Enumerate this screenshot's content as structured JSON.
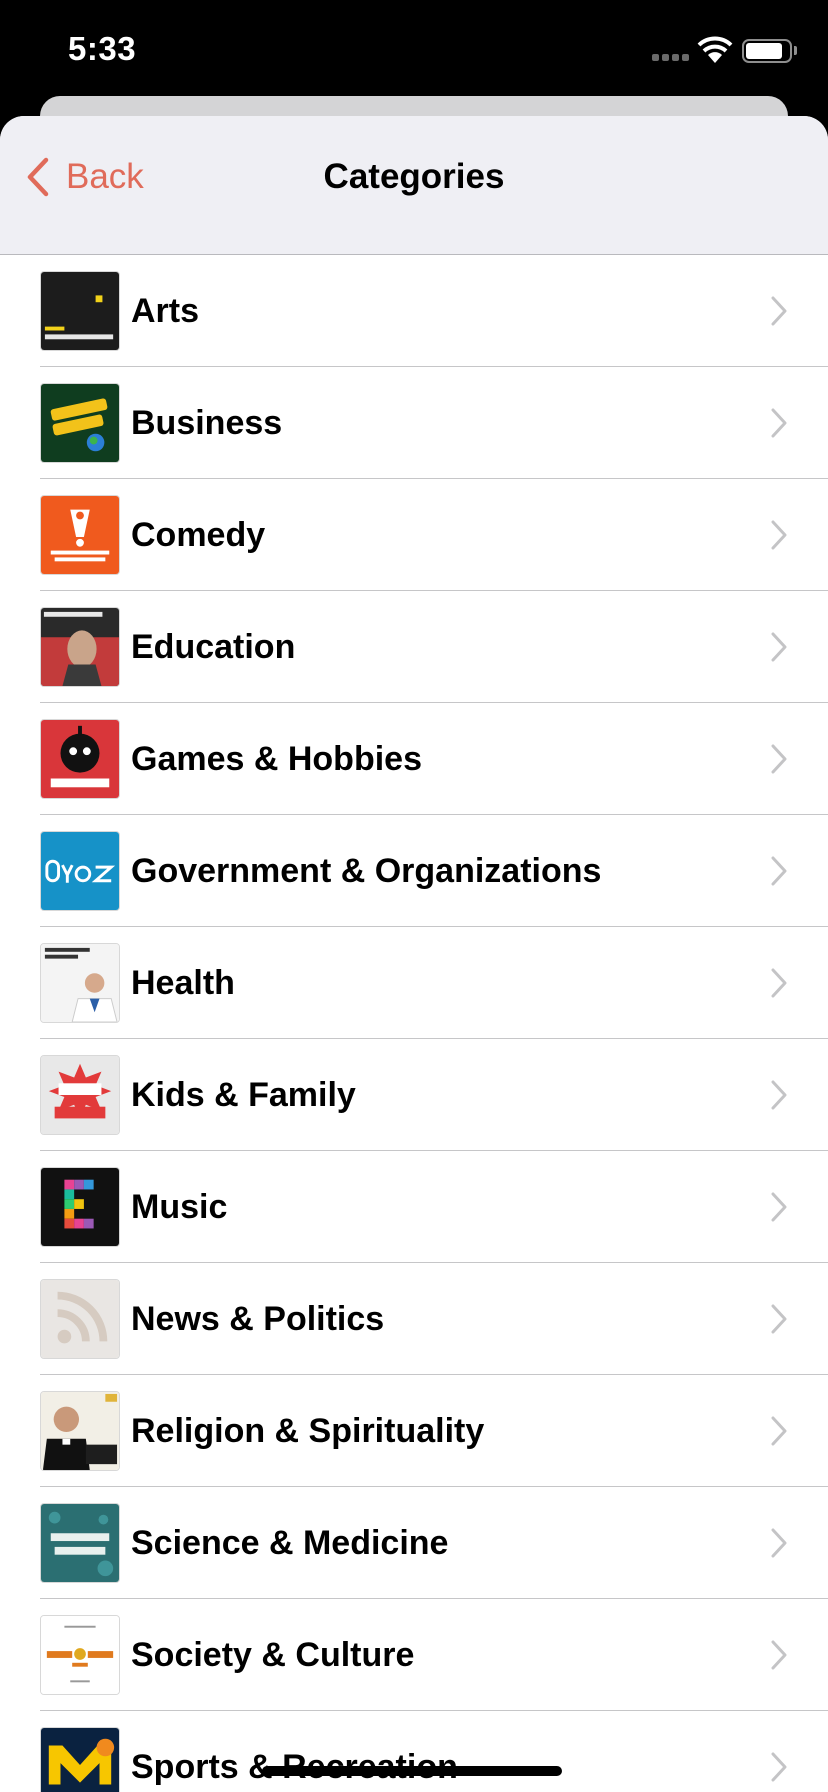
{
  "status_bar": {
    "time": "5:33"
  },
  "nav": {
    "back_label": "Back",
    "title": "Categories"
  },
  "categories": [
    {
      "label": "Arts",
      "thumb_icon": "99-invisible-art",
      "thumb_color": "#1c1c1c"
    },
    {
      "label": "Business",
      "thumb_icon": "planet-money-art",
      "thumb_color": "#0f3d1f"
    },
    {
      "label": "Comedy",
      "thumb_icon": "wait-wait-art",
      "thumb_color": "#f05a1e"
    },
    {
      "label": "Education",
      "thumb_icon": "jordan-peterson-art",
      "thumb_color": "#2a2a2a"
    },
    {
      "label": "Games & Hobbies",
      "thumb_icon": "bombcast-art",
      "thumb_color": "#d9363a"
    },
    {
      "label": "Government & Organizations",
      "thumb_icon": "oyez-art",
      "thumb_color": "#1692c8"
    },
    {
      "label": "Health",
      "thumb_icon": "nutrition-facts-art",
      "thumb_color": "#f4f4f4"
    },
    {
      "label": "Kids & Family",
      "thumb_icon": "wow-in-the-world-art",
      "thumb_color": "#e8e8e8"
    },
    {
      "label": "Music",
      "thumb_icon": "music-e-art",
      "thumb_color": "#111111"
    },
    {
      "label": "News & Politics",
      "thumb_icon": "rss-placeholder-art",
      "thumb_color": "#e9e6e3"
    },
    {
      "label": "Religion & Spirituality",
      "thumb_icon": "bible-in-a-year-art",
      "thumb_color": "#f2efe6"
    },
    {
      "label": "Science & Medicine",
      "thumb_icon": "science-quickly-art",
      "thumb_color": "#2b6f72"
    },
    {
      "label": "Society & Culture",
      "thumb_icon": "freakonomics-art",
      "thumb_color": "#ffffff"
    },
    {
      "label": "Sports & Recreation",
      "thumb_icon": "goblog-art",
      "thumb_color": "#0a2240"
    }
  ],
  "colors": {
    "accent": "#e06b5a",
    "nav_background": "#efeff4",
    "separator": "#c6c6c8",
    "chevron": "#c4c4c6"
  }
}
